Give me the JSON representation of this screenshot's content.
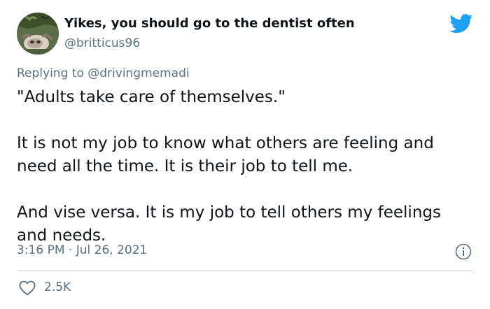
{
  "author": {
    "display_name": "Yikes, you should go to the dentist often",
    "handle": "@britticus96"
  },
  "reply": {
    "prefix": "Replying to ",
    "mention": "@drivingmemadi"
  },
  "tweet": {
    "paragraphs": [
      "\"Adults take care of themselves.\"",
      "It is not my job to know what others are feeling and need all the time. It is their job to tell me.",
      "And vise versa. It is my job to tell others my feelings and needs."
    ],
    "timestamp": "3:16 PM · Jul 26, 2021"
  },
  "stats": {
    "likes": "2.5K"
  },
  "icons": {
    "brand": "twitter-bird-icon",
    "info": "info-icon",
    "like": "heart-icon"
  },
  "colors": {
    "brand_blue": "#1da1f2",
    "text_primary": "#0f1419",
    "text_secondary": "#5b7083",
    "divider": "#cfd9de"
  }
}
